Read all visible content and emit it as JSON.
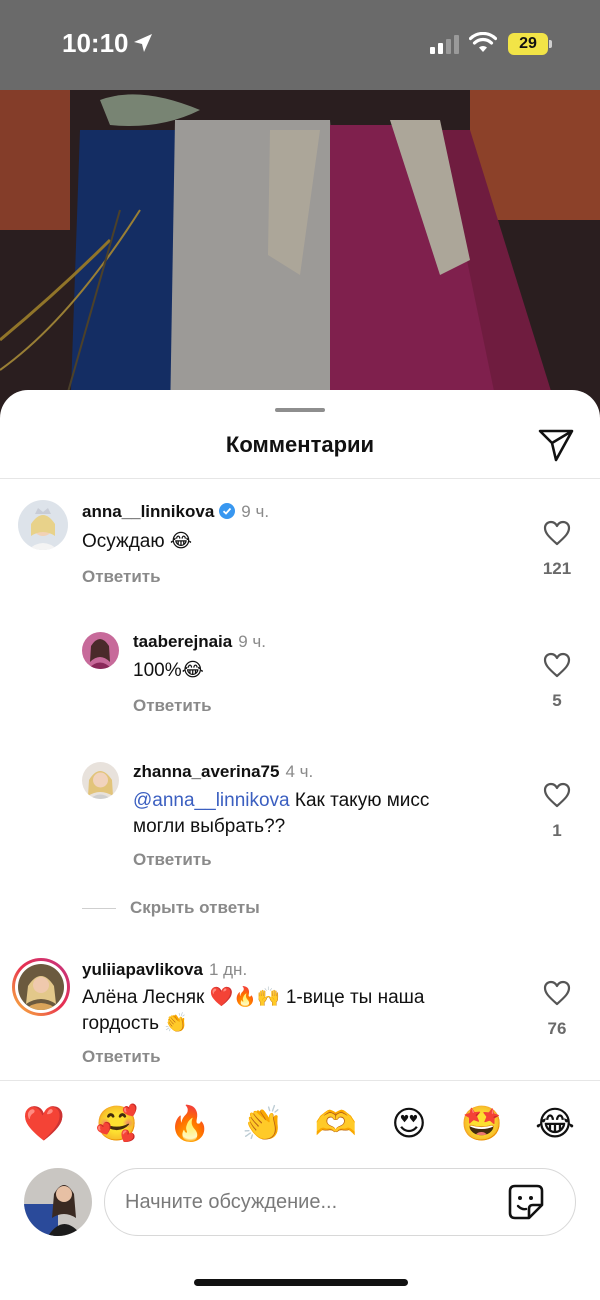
{
  "status_bar": {
    "time": "10:10",
    "battery": "29"
  },
  "sheet": {
    "title": "Комментарии"
  },
  "comments": [
    {
      "username": "anna__linnikova",
      "verified": true,
      "time": "9 ч.",
      "text": "Осуждаю 😂",
      "reply": "Ответить",
      "likes": "121"
    },
    {
      "username": "taaberejnaia",
      "time": "9 ч.",
      "text": "100%😂",
      "reply": "Ответить",
      "likes": "5"
    },
    {
      "username": "zhanna_averina75",
      "time": "4 ч.",
      "mention": "@anna__linnikova",
      "text_line1": " Как такую мисс",
      "text_line2": "могли выбрать??",
      "reply": "Ответить",
      "likes": "1"
    },
    {
      "username": "yuliiapavlikova",
      "time": "1 дн.",
      "text_line1": "Алёна Лесняк ❤️🔥🙌 1-вице ты наша",
      "text_line2": "гордость 👏",
      "reply": "Ответить",
      "likes": "76"
    }
  ],
  "hide_replies": "Скрыть ответы",
  "emoji_bar": [
    "❤️",
    "🥰",
    "🔥",
    "👏",
    "🫶",
    "😍",
    "🤩",
    "😂"
  ],
  "composer": {
    "placeholder": "Начните обсуждение..."
  },
  "icons": {
    "location": "location-arrow-icon",
    "signal": "cellular-signal-icon",
    "wifi": "wifi-icon",
    "share": "paper-plane-icon",
    "heart": "heart-outline-icon",
    "verified": "verified-badge-icon",
    "sticker": "sticker-icon"
  },
  "colors": {
    "mention": "#3b5fc0",
    "verified": "#3897f0",
    "battery": "#f2e447"
  }
}
